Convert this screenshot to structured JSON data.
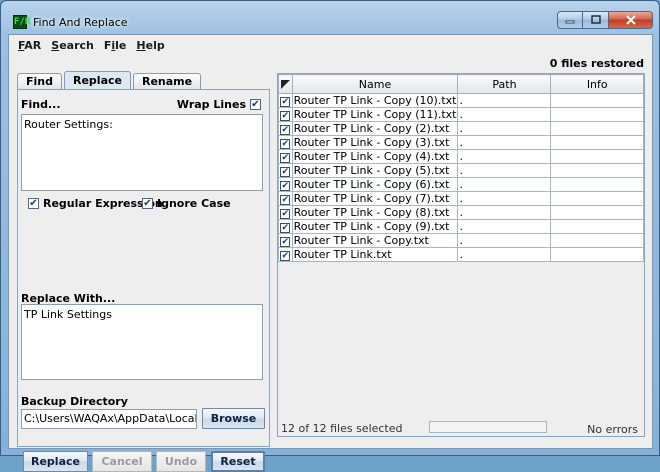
{
  "window": {
    "title": "Find And Replace",
    "app_icon_text": "F∕R"
  },
  "menu": [
    {
      "label": "FAR",
      "mnemonic": "F"
    },
    {
      "label": "Search",
      "mnemonic": "S"
    },
    {
      "label": "File",
      "mnemonic": "i"
    },
    {
      "label": "Help",
      "mnemonic": "H"
    }
  ],
  "status_top": "0 files restored",
  "tabs": [
    {
      "label": "Find",
      "active": false
    },
    {
      "label": "Replace",
      "active": true
    },
    {
      "label": "Rename",
      "active": false
    }
  ],
  "find": {
    "label": "Find...",
    "wrap_lines_label": "Wrap Lines",
    "wrap_lines_checked": true,
    "value": "Router Settings:",
    "regex_label": "Regular Expression",
    "regex_checked": true,
    "ignore_case_label": "Ignore Case",
    "ignore_case_checked": true
  },
  "replace": {
    "label": "Replace With...",
    "value": "TP Link Settings"
  },
  "backup": {
    "label": "Backup Directory",
    "path": "C:\\Users\\WAQAx\\AppData\\Local\\Temp",
    "browse_label": "Browse"
  },
  "buttons": {
    "replace": "Replace",
    "cancel": "Cancel",
    "undo": "Undo",
    "reset": "Reset"
  },
  "table": {
    "columns": [
      "Name",
      "Path",
      "Info"
    ],
    "rows": [
      {
        "checked": true,
        "name": "Router TP Link - Copy (10).txt",
        "path": ".",
        "info": ""
      },
      {
        "checked": true,
        "name": "Router TP Link - Copy (11).txt",
        "path": ".",
        "info": ""
      },
      {
        "checked": true,
        "name": "Router TP Link - Copy (2).txt",
        "path": ".",
        "info": ""
      },
      {
        "checked": true,
        "name": "Router TP Link - Copy (3).txt",
        "path": ".",
        "info": ""
      },
      {
        "checked": true,
        "name": "Router TP Link - Copy (4).txt",
        "path": ".",
        "info": ""
      },
      {
        "checked": true,
        "name": "Router TP Link - Copy (5).txt",
        "path": ".",
        "info": ""
      },
      {
        "checked": true,
        "name": "Router TP Link - Copy (6).txt",
        "path": ".",
        "info": ""
      },
      {
        "checked": true,
        "name": "Router TP Link - Copy (7).txt",
        "path": ".",
        "info": ""
      },
      {
        "checked": true,
        "name": "Router TP Link - Copy (8).txt",
        "path": ".",
        "info": ""
      },
      {
        "checked": true,
        "name": "Router TP Link - Copy (9).txt",
        "path": ".",
        "info": ""
      },
      {
        "checked": true,
        "name": "Router TP Link - Copy.txt",
        "path": ".",
        "info": ""
      },
      {
        "checked": true,
        "name": "Router TP Link.txt",
        "path": ".",
        "info": ""
      }
    ]
  },
  "status_bottom": {
    "selected": "12 of 12 files selected",
    "errors": "No errors"
  }
}
